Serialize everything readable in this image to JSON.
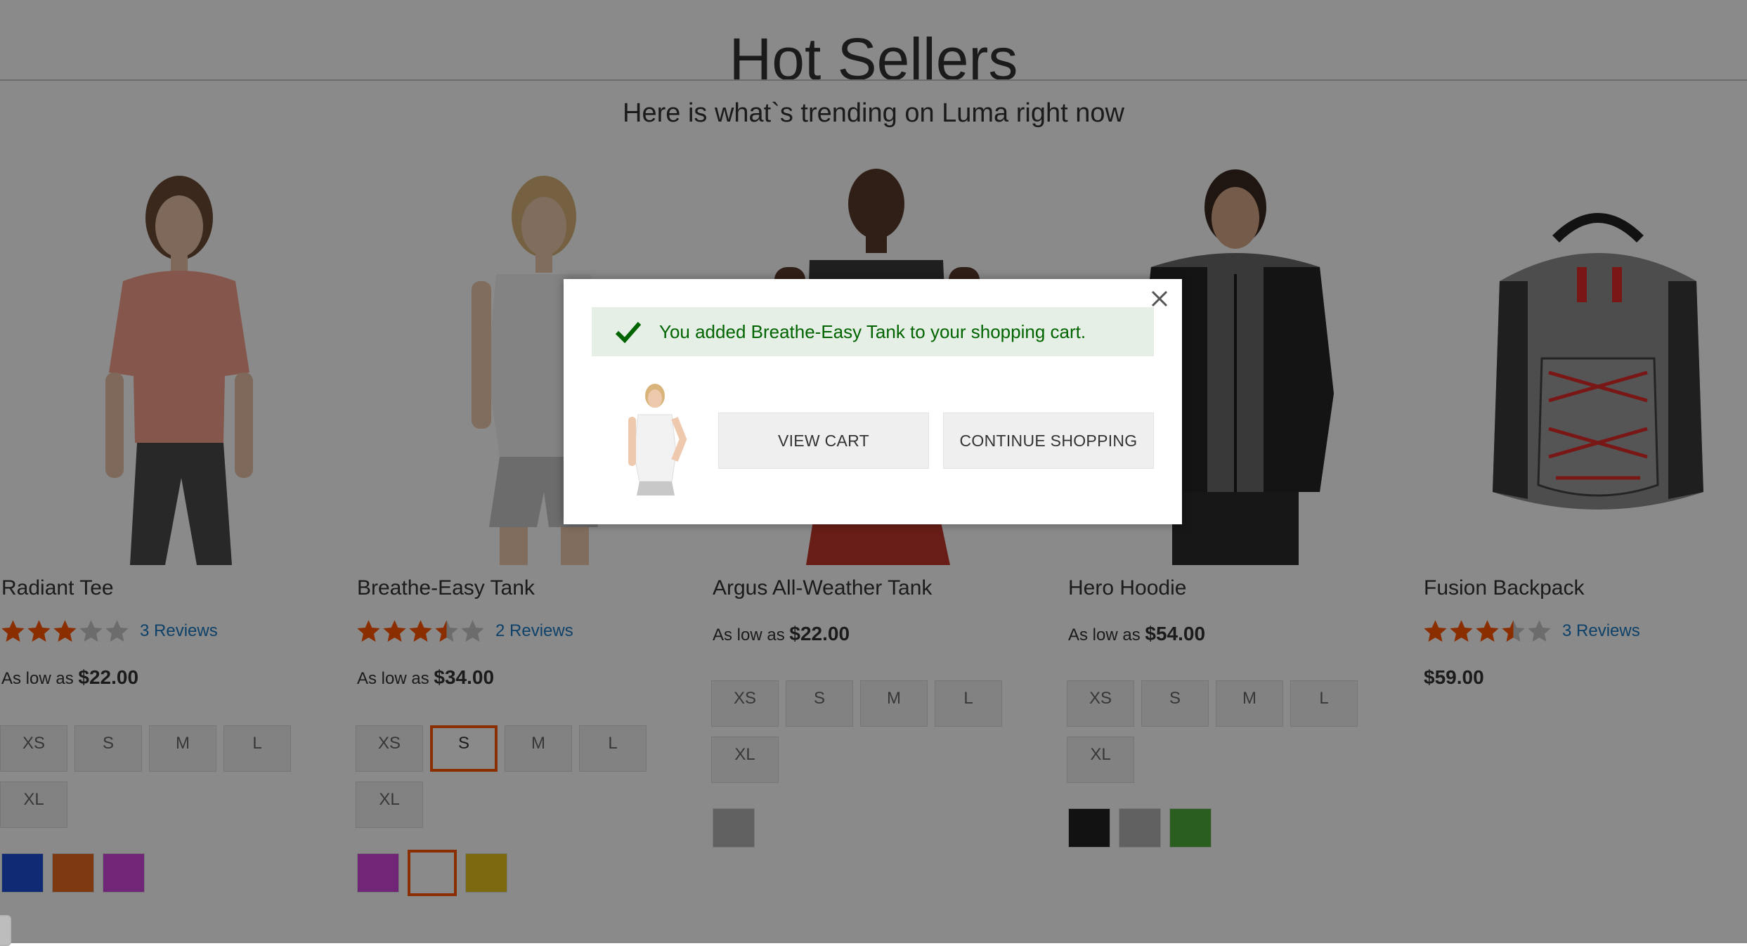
{
  "section": {
    "title": "Hot Sellers",
    "subtitle": "Here is what`s trending on Luma right now"
  },
  "products": [
    {
      "name": "Radiant Tee",
      "rating_stars": 3,
      "reviews": "3 Reviews",
      "price_prefix": "As low as",
      "price": "$22.00",
      "sizes": [
        "XS",
        "S",
        "M",
        "L",
        "XL"
      ],
      "selected_size": null,
      "swatches": [
        "#1f4fd6",
        "#eb6a1f",
        "#cf45db"
      ],
      "selected_swatch": null
    },
    {
      "name": "Breathe-Easy Tank",
      "rating_stars": 3.5,
      "reviews": "2 Reviews",
      "price_prefix": "As low as",
      "price": "$34.00",
      "sizes": [
        "XS",
        "S",
        "M",
        "L",
        "XL"
      ],
      "selected_size": "S",
      "swatches": [
        "#cf45db",
        "#ffffff",
        "#e6c21e"
      ],
      "selected_swatch": 1
    },
    {
      "name": "Argus All-Weather Tank",
      "rating_stars": null,
      "reviews": "",
      "price_prefix": "As low as",
      "price": "$22.00",
      "sizes": [
        "XS",
        "S",
        "M",
        "L",
        "XL"
      ],
      "selected_size": null,
      "swatches": [
        "#b3b3b3"
      ],
      "selected_swatch": null
    },
    {
      "name": "Hero Hoodie",
      "rating_stars": null,
      "reviews": "",
      "price_prefix": "As low as",
      "price": "$54.00",
      "sizes": [
        "XS",
        "S",
        "M",
        "L",
        "XL"
      ],
      "selected_size": null,
      "swatches": [
        "#222222",
        "#b3b3b3",
        "#4cae3a"
      ],
      "selected_swatch": null
    },
    {
      "name": "Fusion Backpack",
      "rating_stars": 3.5,
      "reviews": "3 Reviews",
      "price_prefix": "",
      "price": "$59.00",
      "sizes": [],
      "selected_size": null,
      "swatches": [],
      "selected_swatch": null
    }
  ],
  "modal": {
    "message": "You added Breathe-Easy Tank to your shopping cart.",
    "view_cart_label": "VIEW CART",
    "continue_label": "CONTINUE SHOPPING"
  },
  "colors": {
    "star_filled": "#ff5501",
    "star_empty": "#c7c7c7",
    "link": "#1979c3",
    "success_bg": "#e5efe5",
    "success_text": "#006400",
    "overlay": "rgba(0,0,0,0.46)"
  },
  "icons": [
    "close-icon",
    "checkmark-icon",
    "star-icon"
  ]
}
